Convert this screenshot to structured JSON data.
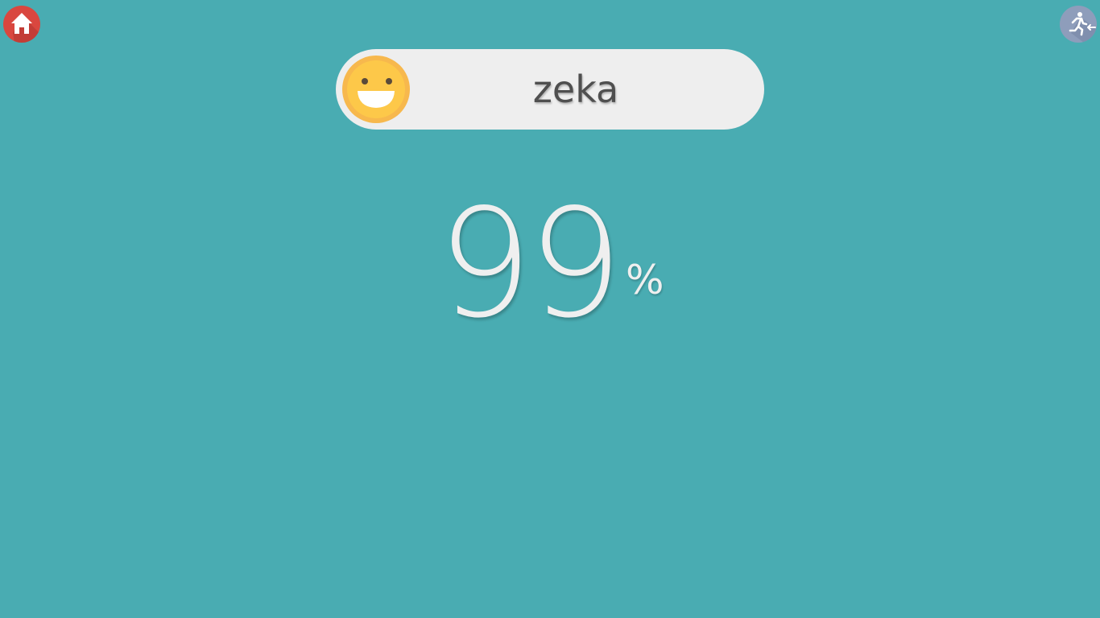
{
  "colors": {
    "background": "#49acb2",
    "home_button": "#d9473f",
    "exit_button": "#8e9dbb",
    "pill": "#eeeeee",
    "smiley": "#fdc849",
    "text_light": "#efefef",
    "text_dark": "#4f4f4f"
  },
  "home_button": {
    "icon": "home-icon"
  },
  "exit_button": {
    "icon": "exit-running-icon"
  },
  "result": {
    "mood_icon": "grinning-face-icon",
    "label": "zeka",
    "score": "99",
    "unit": "%"
  }
}
